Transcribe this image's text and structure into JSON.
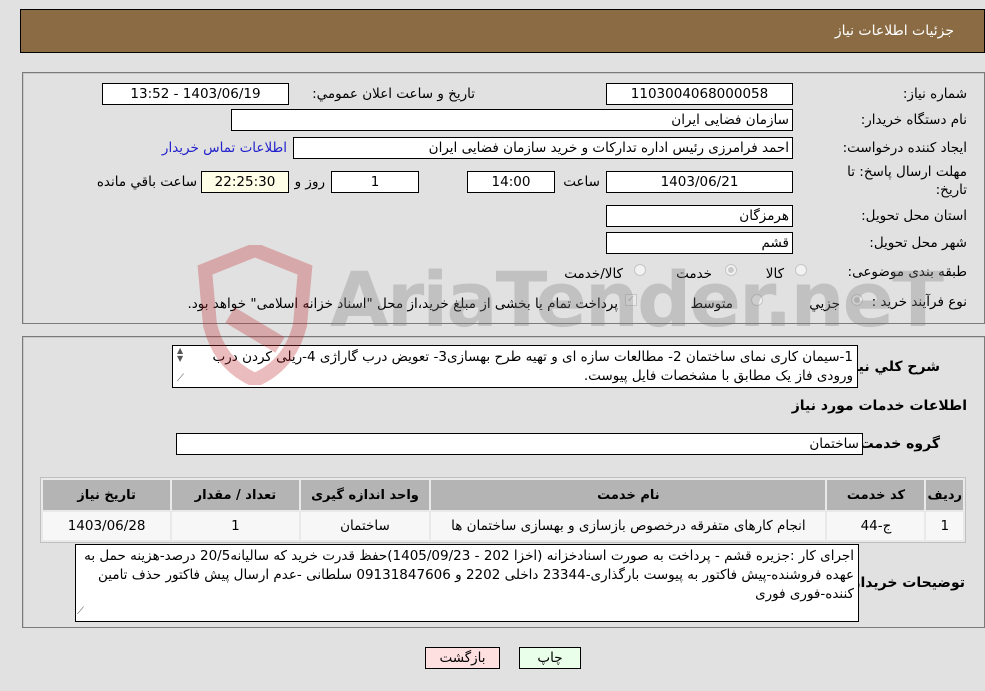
{
  "header": {
    "title": "جزئیات اطلاعات نیاز"
  },
  "fields": {
    "need_number": {
      "label": "شماره نیاز:",
      "value": "1103004068000058"
    },
    "announce_datetime": {
      "label": "تاریخ و ساعت اعلان عمومي:",
      "value": "1403/06/19 - 13:52"
    },
    "buyer_org": {
      "label": "نام دستگاه خريدار:",
      "value": "سازمان فضایی ایران"
    },
    "requester": {
      "label": "ایجاد کننده درخواست:",
      "value": "احمد فرامرزی رئیس اداره تدارکات و خرید سازمان فضایی ایران"
    },
    "buyer_contact_link": "اطلاعات تماس خريدار",
    "deadline": {
      "label_line1": "مهلت ارسال پاسخ: تا",
      "label_line2": "تاریخ:",
      "date": "1403/06/21",
      "time_label": "ساعت",
      "time": "14:00",
      "days": "1",
      "days_label": "روز و",
      "remaining": "22:25:30",
      "remaining_label": "ساعت باقي مانده"
    },
    "province": {
      "label": "استان محل تحویل:",
      "value": "هرمزگان"
    },
    "city": {
      "label": "شهر محل تحویل:",
      "value": "قشم"
    },
    "category": {
      "label": "طبقه بندی موضوعی:",
      "options": [
        "کالا",
        "خدمت",
        "کالا/خدمت"
      ],
      "selected": "خدمت"
    },
    "purchase_type": {
      "label": "نوع فرآیند خرید :",
      "options": [
        "جزيي",
        "متوسط"
      ],
      "selected": "جزيي",
      "treasury_checkbox_label": "پرداخت تمام يا بخشی از مبلغ خرید،از محل \"اسناد خزانه اسلامی\" خواهد بود.",
      "treasury_checked": true
    }
  },
  "description": {
    "label": "شرح کلي نياز:",
    "text": "1-سیمان کاری نمای ساختمان 2- مطالعات سازه ای و تهیه طرح بهسازی3- تعویض درب گاراژی 4-ریلی کردن درب ورودی فاز یک مطابق با مشخصات فایل پیوست."
  },
  "services_section": {
    "title": "اطلاعات خدمات مورد نياز",
    "service_group_label": "گروه خدمت:",
    "service_group_value": "ساختمان",
    "table": {
      "columns": [
        "رديف",
        "کد خدمت",
        "نام خدمت",
        "واحد اندازه گیری",
        "تعداد / مقدار",
        "تاريخ نياز"
      ],
      "rows": [
        [
          "1",
          "ج-44",
          "انجام کارهای متفرقه درخصوص بازسازی و بهسازی ساختمان ها",
          "ساختمان",
          "1",
          "1403/06/28"
        ]
      ]
    }
  },
  "buyer_notes": {
    "label": "توضيحات خريدار:",
    "text": "اجرای کار :جزیره قشم - پرداخت به صورت اسنادخزانه (اخزا 202 - 1405/09/23)حفظ قدرت خرید که سالیانه20/5 درصد-هزینه حمل به عهده فروشنده-پیش فاکتور به پیوست بارگذاری-23344 داخلی 2202 و 09131847606 سلطانی -عدم ارسال پیش فاکتور حذف تامین کننده-فوری فوری"
  },
  "buttons": {
    "print": "چاپ",
    "back": "بازگشت"
  },
  "watermark": "AriaTender.neT",
  "colors": {
    "header_bg": "#8b6b43",
    "print_bg": "#eaffea",
    "back_bg": "#ffe0e0",
    "link": "#2222cc"
  }
}
